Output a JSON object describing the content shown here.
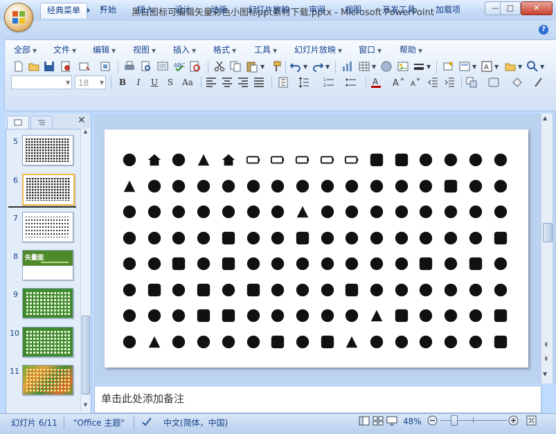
{
  "window": {
    "title": "黑白图标可编辑矢量彩色小图标ppt素材下载.pptx - Microsoft PowerPoint",
    "min_label": "—",
    "max_label": "□",
    "close_label": "✕"
  },
  "tabs": [
    "经典菜单",
    "开始",
    "插入",
    "设计",
    "动画",
    "幻灯片放映",
    "审阅",
    "视图",
    "开发工具",
    "加载项"
  ],
  "active_tab": "经典菜单",
  "classic_menus": [
    "全部",
    "文件",
    "编辑",
    "视图",
    "插入",
    "格式",
    "工具",
    "幻灯片放映",
    "窗口",
    "帮助"
  ],
  "font_size_value": "18",
  "format_buttons": [
    "B",
    "I",
    "U",
    "S",
    "Aa"
  ],
  "slides_panel": {
    "close_label": "✕",
    "slides": [
      {
        "num": "5"
      },
      {
        "num": "6"
      },
      {
        "num": "7"
      },
      {
        "num": "8",
        "thumb_title": "矢量图"
      },
      {
        "num": "9"
      },
      {
        "num": "10"
      },
      {
        "num": "11"
      }
    ]
  },
  "notes_placeholder": "单击此处添加备注",
  "status": {
    "slide_indicator": "幻灯片 6/11",
    "theme": "\"Office 主题\"",
    "language": "中文(简体，中国)",
    "zoom": "48%"
  },
  "colors": {
    "ribbon_bg": "#dde9f8",
    "accent": "#15428b",
    "close_red": "#c8412e"
  },
  "slide_icons": [
    [
      "target",
      "bank",
      "cupcake",
      "pizza",
      "home",
      "battery-empty",
      "battery-full",
      "battery-mid",
      "battery-low",
      "battery-outline",
      "money",
      "ticket",
      "ufo",
      "pin",
      "hanger",
      "paw"
    ],
    [
      "broom",
      "log",
      "submarine",
      "ship",
      "sock",
      "football",
      "basketball",
      "soccer",
      "bicycle",
      "orange",
      "ruler",
      "pie",
      "cassette",
      "id-card",
      "sun",
      "watermelon"
    ],
    [
      "bomb",
      "octopus",
      "elephant",
      "bird",
      "banana",
      "ring",
      "tree",
      "rocket",
      "owl",
      "balloon",
      "chicken",
      "ghost",
      "frankenstein",
      "pushpin",
      "piano",
      "chat"
    ],
    [
      "mail",
      "button",
      "usb",
      "network",
      "box",
      "mustache",
      "fire",
      "calculator",
      "google-plus",
      "dots",
      "at",
      "flower",
      "behance",
      "behance-text",
      "whatsapp",
      "whatsapp-square"
    ],
    [
      "whatsapp-round",
      "deviantart",
      "deviantart-square",
      "deviantart-alt",
      "klout",
      "vimeo",
      "vimeo-alt",
      "youtube",
      "linkedin",
      "drop",
      "linkedin-text",
      "rss",
      "rss-square",
      "rss-plain",
      "google-plus-square",
      "google-plus-text"
    ],
    [
      "dribbble",
      "dribbble-square",
      "flickr",
      "flickr-square",
      "flickr-dots",
      "bird-square",
      "cat",
      "twitter",
      "facebook",
      "facebook-square",
      "facebook-text",
      "glasses-wine",
      "zoom-out",
      "zoom-in",
      "power",
      "music"
    ],
    [
      "hand",
      "eraser",
      "sunglasses",
      "bookshelf",
      "picture",
      "gamepad",
      "gamepad-alt",
      "plug",
      "speaker",
      "microphone",
      "pen",
      "ipod",
      "scissors",
      "thought",
      "cd",
      "list"
    ],
    [
      "skull",
      "lightning",
      "cup",
      "laptop",
      "squirrel",
      "plus",
      "close-box",
      "close",
      "checkbox",
      "pen-nib",
      "keyboard",
      "mouse",
      "people",
      "user-ring",
      "user",
      "document"
    ]
  ]
}
